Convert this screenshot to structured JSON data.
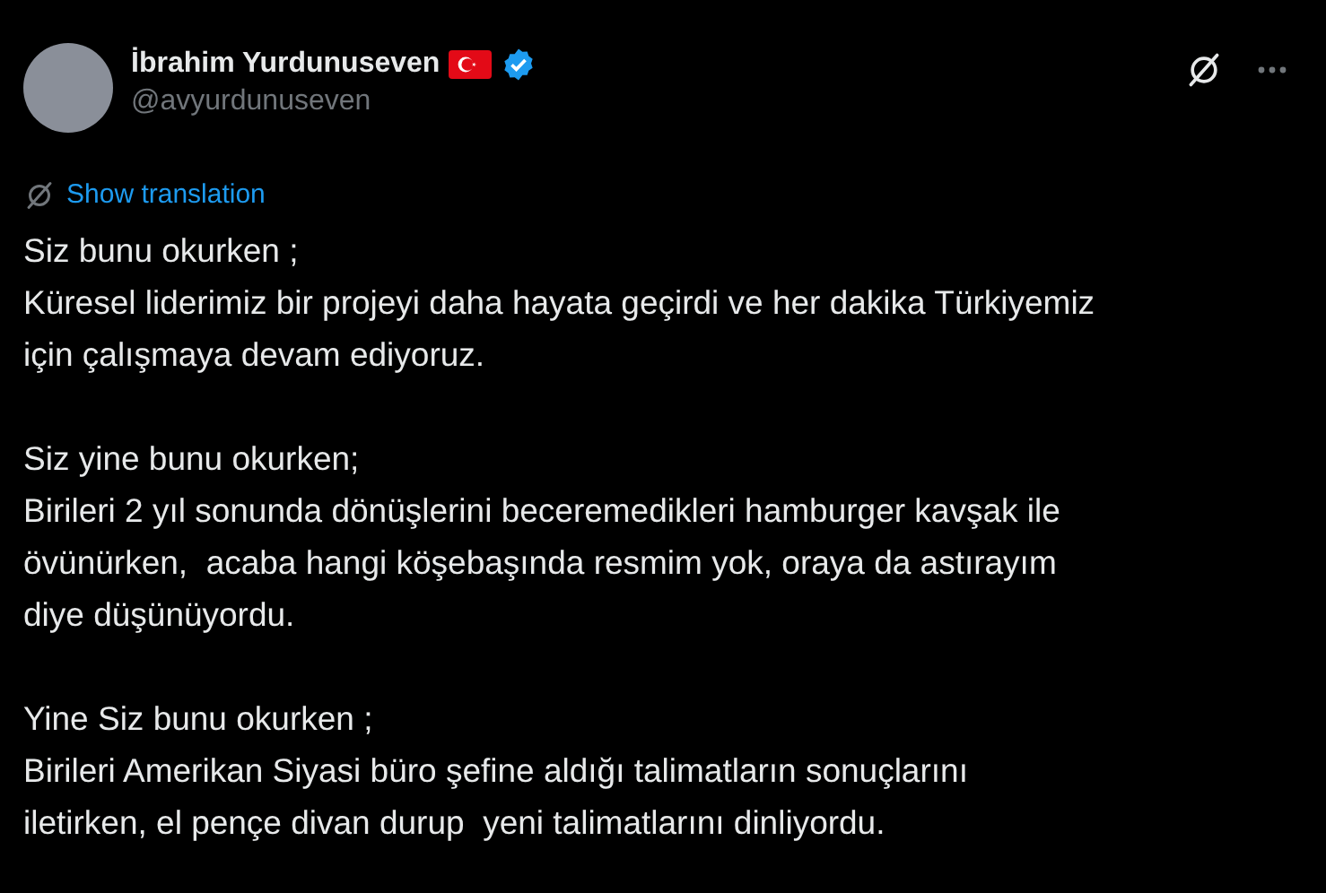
{
  "author": {
    "name": "İbrahim Yurdunuseven",
    "handle": "@avyurdunuseven",
    "verified": true
  },
  "translation_link": "Show translation",
  "paragraphs": [
    "Siz bunu okurken ;\nKüresel liderimiz bir projeyi daha hayata geçirdi ve her dakika Türkiyemiz\niçin çalışmaya devam ediyoruz.",
    "Siz yine bunu okurken;\nBirileri 2 yıl sonunda dönüşlerini beceremedikleri hamburger kavşak ile\növünürken,  acaba hangi köşebaşında resmim yok, oraya da astırayım\ndiye düşünüyordu.",
    "Yine Siz bunu okurken ;\nBirileri Amerikan Siyasi büro şefine aldığı talimatların sonuçlarını\niletirken, el pençe divan durup  yeni talimatlarını dinliyordu."
  ]
}
